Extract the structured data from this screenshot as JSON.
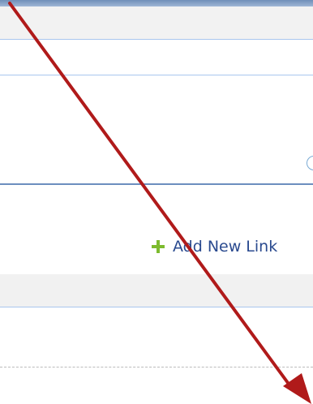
{
  "links": {
    "add_label": "Add New Link",
    "add_icon": "plus-icon"
  },
  "colors": {
    "accent_line": "#a9c6ee",
    "dark_line": "#6c8ebf",
    "link_text": "#2a4a8f",
    "plus_green": "#7dbb2e",
    "arrow_red": "#b01a1a"
  }
}
